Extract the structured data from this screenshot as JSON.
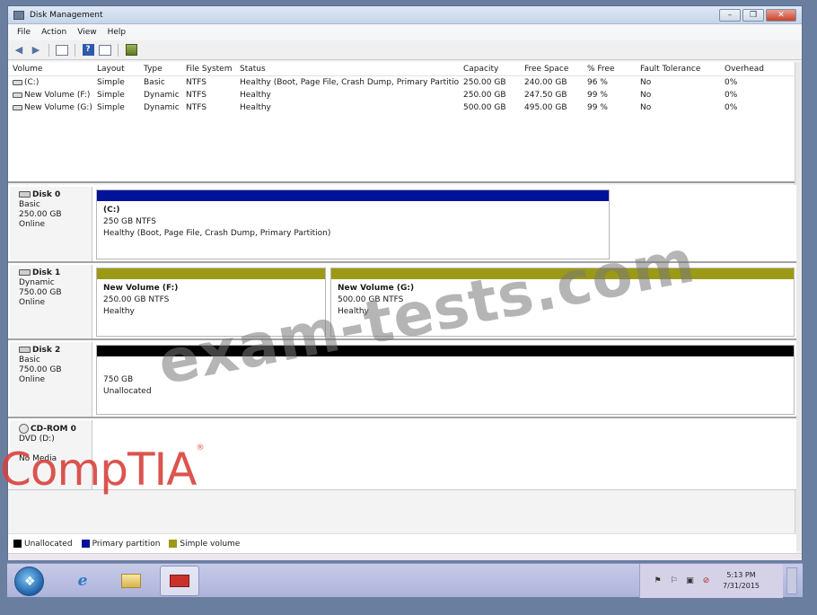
{
  "window": {
    "title": "Disk Management",
    "controls": [
      "–",
      "❒",
      "✕"
    ]
  },
  "menu": [
    "File",
    "Action",
    "View",
    "Help"
  ],
  "toolbar_icons": [
    "back-icon",
    "forward-icon",
    "console-tree-icon",
    "help-icon",
    "properties-icon",
    "refresh-icon"
  ],
  "volume_table": {
    "columns": [
      "Volume",
      "Layout",
      "Type",
      "File System",
      "Status",
      "Capacity",
      "Free Space",
      "% Free",
      "Fault Tolerance",
      "Overhead"
    ],
    "rows": [
      [
        "(C:)",
        "Simple",
        "Basic",
        "NTFS",
        "Healthy (Boot, Page File, Crash Dump, Primary Partition)",
        "250.00 GB",
        "240.00 GB",
        "96 %",
        "No",
        "0%"
      ],
      [
        "New Volume (F:)",
        "Simple",
        "Dynamic",
        "NTFS",
        "Healthy",
        "250.00 GB",
        "247.50 GB",
        "99 %",
        "No",
        "0%"
      ],
      [
        "New Volume (G:)",
        "Simple",
        "Dynamic",
        "NTFS",
        "Healthy",
        "500.00 GB",
        "495.00 GB",
        "99 %",
        "No",
        "0%"
      ]
    ]
  },
  "disks": [
    {
      "name": "Disk 0",
      "type": "Basic",
      "size": "250.00 GB",
      "state": "Online",
      "partitions": [
        {
          "title": "(C:)",
          "detail": "250 GB NTFS",
          "status": "Healthy (Boot, Page File, Crash Dump, Primary Partition)",
          "color": "#00129a"
        }
      ]
    },
    {
      "name": "Disk 1",
      "type": "Dynamic",
      "size": "750.00 GB",
      "state": "Online",
      "partitions": [
        {
          "title": "New Volume (F:)",
          "detail": "250.00 GB NTFS",
          "status": "Healthy",
          "color": "#9c9a14"
        },
        {
          "title": "New Volume (G:)",
          "detail": "500.00 GB NTFS",
          "status": "Healthy",
          "color": "#9c9a14"
        }
      ]
    },
    {
      "name": "Disk 2",
      "type": "Basic",
      "size": "750.00 GB",
      "state": "Online",
      "partitions": [
        {
          "title": "",
          "detail": "750 GB",
          "status": "Unallocated",
          "color": "#000000"
        }
      ]
    },
    {
      "name": "CD-ROM 0",
      "type": "DVD (D:)",
      "size": "",
      "state": "No Media",
      "partitions": []
    }
  ],
  "legend": [
    {
      "label": "Unallocated",
      "color": "#000000"
    },
    {
      "label": "Primary partition",
      "color": "#00129a"
    },
    {
      "label": "Simple volume",
      "color": "#9c9a14"
    }
  ],
  "taskbar": {
    "apps": [
      "internet-explorer-icon",
      "windows-explorer-icon",
      "computer-management-icon"
    ],
    "clock_time": "5:13 PM",
    "clock_date": "7/31/2015"
  },
  "overlays": {
    "watermark": "exam-tests.com",
    "brand": "CompTIA"
  }
}
